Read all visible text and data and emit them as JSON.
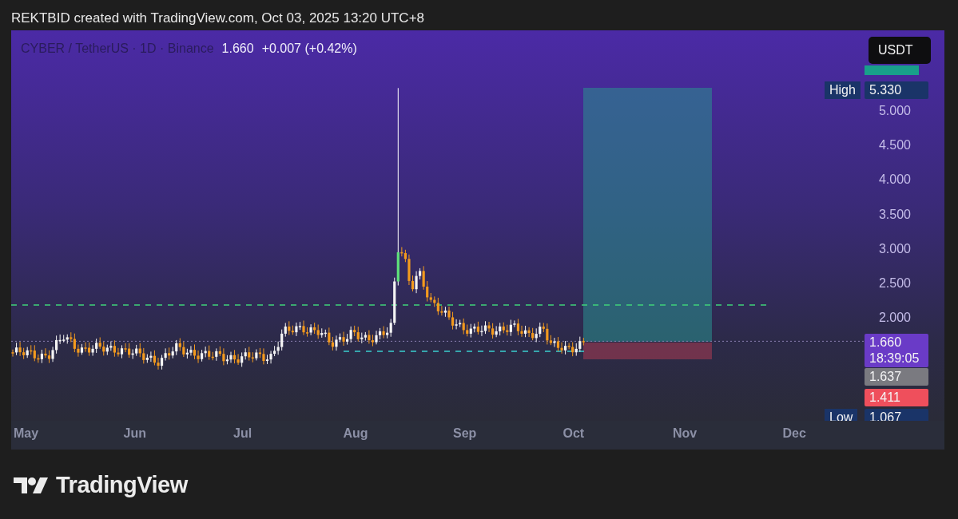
{
  "caption": "REKTBID created with TradingView.com, Oct 03, 2025 13:20 UTC+8",
  "legend": {
    "symbol": "CYBER / TetherUS · 1D · Binance",
    "price": "1.660",
    "change": "+0.007 (+0.42%)"
  },
  "currency_button": "USDT",
  "price_ticks": [
    "5.000",
    "4.500",
    "4.000",
    "3.500",
    "3.000",
    "2.500",
    "2.000"
  ],
  "price_labels": [
    {
      "kind": "high",
      "label": "High",
      "value": "5.330"
    },
    {
      "kind": "last",
      "value": "1.660",
      "countdown": "18:39:05"
    },
    {
      "kind": "entry",
      "value": "1.637"
    },
    {
      "kind": "stop",
      "value": "1.411"
    },
    {
      "kind": "low",
      "label": "Low",
      "value": "1.067"
    }
  ],
  "time_ticks": [
    "May",
    "Jun",
    "Jul",
    "Aug",
    "Sep",
    "Oct",
    "Nov",
    "Dec"
  ],
  "brand": "TradingView"
}
